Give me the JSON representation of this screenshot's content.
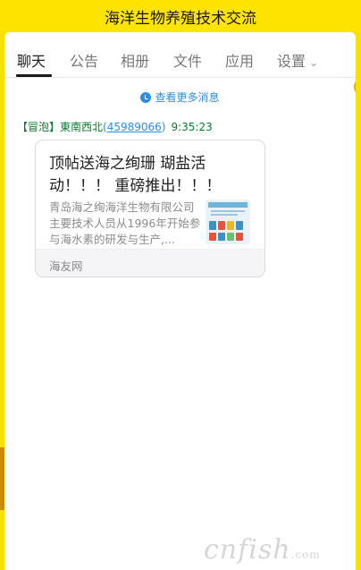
{
  "window": {
    "title": "海洋生物养殖技术交流"
  },
  "tabs": [
    {
      "label": "聊天",
      "active": true
    },
    {
      "label": "公告"
    },
    {
      "label": "相册"
    },
    {
      "label": "文件"
    },
    {
      "label": "应用"
    },
    {
      "label": "设置"
    }
  ],
  "chat": {
    "more_messages": "查看更多消息",
    "message": {
      "badge": "【冒泡】",
      "sender": "東南西北",
      "qq": "45989066",
      "time": "9:35:23",
      "card": {
        "title": "顶帖送海之绚珊 瑚盐活动！！！ 重磅推出！！！",
        "description": "青岛海之绚海洋生物有限公司主要技术人员从1996年开始参与海水素的研发与生产,...",
        "source": "海友网"
      }
    }
  },
  "watermark": {
    "main": "cnfish",
    "suffix": ".com"
  }
}
